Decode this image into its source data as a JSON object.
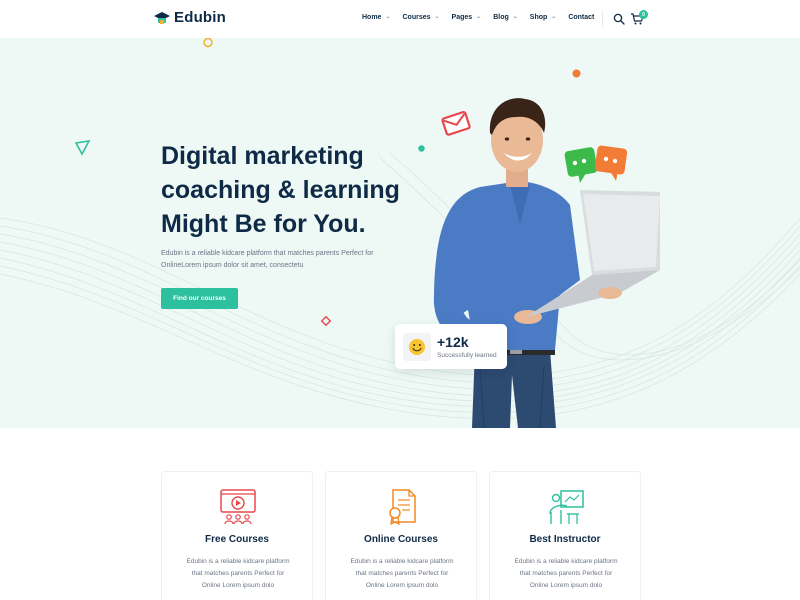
{
  "brand": {
    "name": "Edubin",
    "accent": "#2dc09f",
    "dark": "#0e2a46"
  },
  "nav": {
    "items": [
      {
        "label": "Home",
        "dropdown": true
      },
      {
        "label": "Courses",
        "dropdown": true
      },
      {
        "label": "Pages",
        "dropdown": true
      },
      {
        "label": "Blog",
        "dropdown": true
      },
      {
        "label": "Shop",
        "dropdown": true
      },
      {
        "label": "Contact",
        "dropdown": false
      }
    ],
    "cart_count": "0",
    "icons": [
      "search-icon",
      "cart-icon"
    ]
  },
  "hero": {
    "title_lines": [
      "Digital marketing",
      "coaching & learning",
      "Might Be for You."
    ],
    "description_lines": [
      "Edubin is a reliable kidcare platform that matches parents Perfect for",
      "OnlineLorem ipsum dolor sit amet, consectetu"
    ],
    "cta_label": "Find our courses",
    "stat": {
      "value": "+12k",
      "label": "Successfully learned",
      "icon": "smiley-icon"
    }
  },
  "features": [
    {
      "title": "Free Courses",
      "icon": "video-class-icon",
      "icon_color": "#e5484d",
      "desc_lines": [
        "Edubin is a reliable kidcare platform",
        "that matches parents Perfect for",
        "Online Lorem ipsum dolo"
      ]
    },
    {
      "title": "Online Courses",
      "icon": "certificate-icon",
      "icon_color": "#f08a24",
      "desc_lines": [
        "Edubin is a reliable kidcare platform",
        "that matches parents Perfect for",
        "Online Lorem ipsum dolo"
      ]
    },
    {
      "title": "Best Instructor",
      "icon": "instructor-board-icon",
      "icon_color": "#2dc09f",
      "desc_lines": [
        "Edubin is a reliable kidcare platform",
        "that matches parents Perfect for",
        "Online Lorem ipsum dolo"
      ]
    }
  ]
}
